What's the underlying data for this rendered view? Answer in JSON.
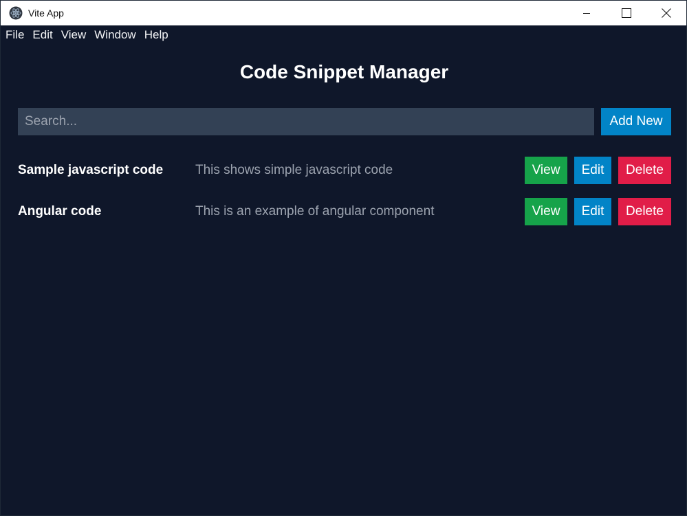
{
  "window": {
    "title": "Vite App",
    "controls": {
      "minimize_icon": "minimize-icon",
      "maximize_icon": "maximize-icon",
      "close_icon": "close-icon"
    }
  },
  "menu": [
    "File",
    "Edit",
    "View",
    "Window",
    "Help"
  ],
  "page": {
    "title": "Code Snippet Manager"
  },
  "search": {
    "placeholder": "Search...",
    "value": ""
  },
  "toolbar": {
    "add_label": "Add New"
  },
  "snippets": [
    {
      "title": "Sample javascript code",
      "description": "This shows simple javascript code",
      "view_label": "View",
      "edit_label": "Edit",
      "delete_label": "Delete"
    },
    {
      "title": "Angular code",
      "description": "This is an example of angular component",
      "view_label": "View",
      "edit_label": "Edit",
      "delete_label": "Delete"
    }
  ],
  "colors": {
    "background": "#0f172a",
    "input_bg": "#334155",
    "primary": "#0284c7",
    "success": "#16a34a",
    "danger": "#e11d48"
  }
}
